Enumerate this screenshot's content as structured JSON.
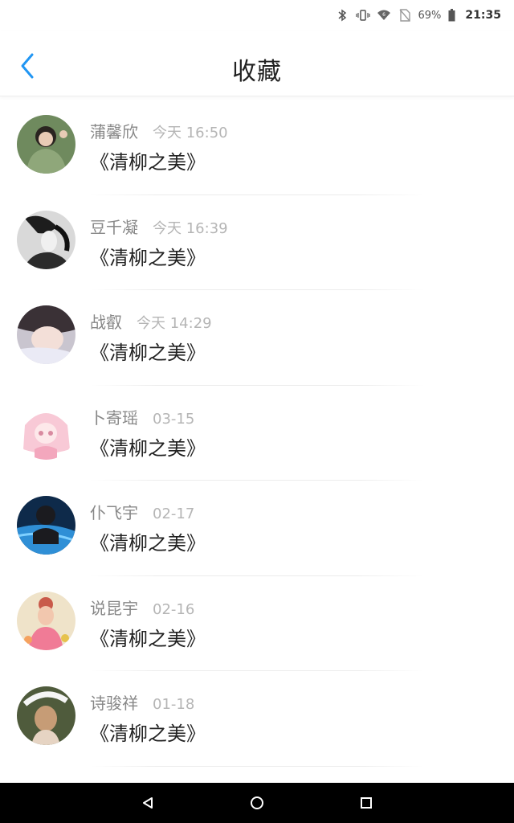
{
  "status_bar": {
    "battery": "69%",
    "time": "21:35"
  },
  "header": {
    "title": "收藏"
  },
  "favorites": [
    {
      "user": "蒲馨欣",
      "time": "今天 16:50",
      "title": "《清柳之美》"
    },
    {
      "user": "豆千凝",
      "time": "今天 16:39",
      "title": "《清柳之美》"
    },
    {
      "user": "战叡",
      "time": "今天 14:29",
      "title": "《清柳之美》"
    },
    {
      "user": "卜寄瑶",
      "time": "03-15",
      "title": "《清柳之美》"
    },
    {
      "user": "仆飞宇",
      "time": "02-17",
      "title": "《清柳之美》"
    },
    {
      "user": "说昆宇",
      "time": "02-16",
      "title": "《清柳之美》"
    },
    {
      "user": "诗骏祥",
      "time": "01-18",
      "title": "《清柳之美》"
    }
  ],
  "colors": {
    "accent": "#2196F3",
    "nav_bar": "#000000"
  }
}
